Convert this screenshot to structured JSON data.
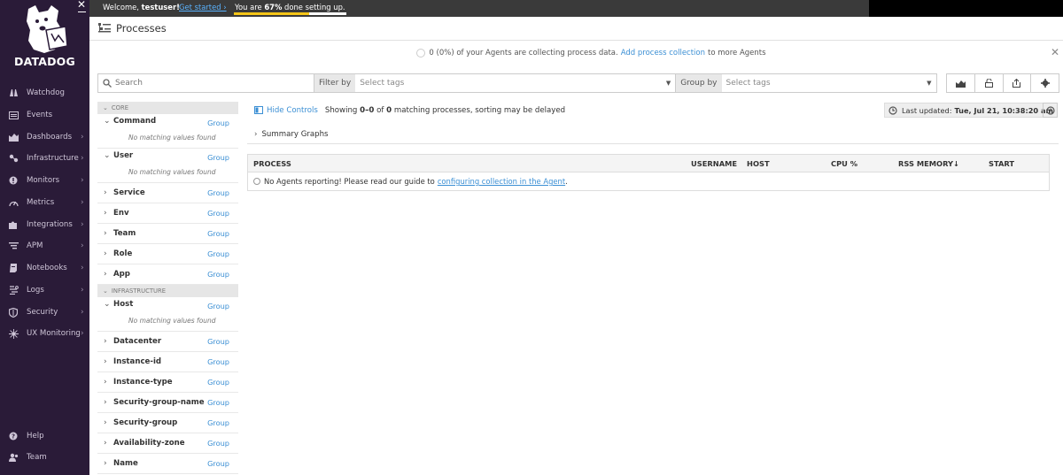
{
  "sidebar": {
    "brand": "DATADOG",
    "items": [
      {
        "label": "Watchdog",
        "icon": "binoculars-icon",
        "chevron": ""
      },
      {
        "label": "Events",
        "icon": "events-icon",
        "chevron": ""
      },
      {
        "label": "Dashboards",
        "icon": "dashboard-icon",
        "chevron": "›"
      },
      {
        "label": "Infrastructure",
        "icon": "infrastructure-icon",
        "chevron": "›"
      },
      {
        "label": "Monitors",
        "icon": "monitor-icon",
        "chevron": "›"
      },
      {
        "label": "Metrics",
        "icon": "metrics-icon",
        "chevron": "›"
      },
      {
        "label": "Integrations",
        "icon": "puzzle-icon",
        "chevron": "›"
      },
      {
        "label": "APM",
        "icon": "apm-icon",
        "chevron": "›"
      },
      {
        "label": "Notebooks",
        "icon": "notebook-icon",
        "chevron": "›"
      },
      {
        "label": "Logs",
        "icon": "logs-icon",
        "chevron": "›"
      },
      {
        "label": "Security",
        "icon": "shield-icon",
        "chevron": "›"
      },
      {
        "label": "UX Monitoring",
        "icon": "ux-icon",
        "chevron": "›"
      }
    ],
    "bottom_items": [
      {
        "label": "Help",
        "icon": "help-icon"
      },
      {
        "label": "Team",
        "icon": "team-icon"
      }
    ]
  },
  "topbar": {
    "welcome_prefix": "Welcome, ",
    "username": "testuser!",
    "get_started": "Get started ›",
    "progress_prefix": "You are ",
    "progress_percent_text": "67%",
    "progress_suffix": " done setting up.",
    "progress_value": 0.67
  },
  "header": {
    "title": "Processes"
  },
  "banner": {
    "text_before": "0 (0%) of your Agents are collecting process data.",
    "link": "Add process collection",
    "text_after": "to more Agents"
  },
  "search": {
    "placeholder": "Search",
    "filter_label": "Filter by",
    "filter_placeholder": "Select tags",
    "group_label": "Group by",
    "group_placeholder": "Select tags"
  },
  "facets": {
    "core_label": "CORE",
    "infra_label": "INFRASTRUCTURE",
    "group_label": "Group",
    "no_match": "No matching values found",
    "core": [
      {
        "name": "Command",
        "expanded": true
      },
      {
        "name": "User",
        "expanded": true
      },
      {
        "name": "Service",
        "expanded": false
      },
      {
        "name": "Env",
        "expanded": false
      },
      {
        "name": "Team",
        "expanded": false
      },
      {
        "name": "Role",
        "expanded": false
      },
      {
        "name": "App",
        "expanded": false
      }
    ],
    "infra": [
      {
        "name": "Host",
        "expanded": true
      },
      {
        "name": "Datacenter",
        "expanded": false
      },
      {
        "name": "Instance-id",
        "expanded": false
      },
      {
        "name": "Instance-type",
        "expanded": false
      },
      {
        "name": "Security-group-name",
        "expanded": false
      },
      {
        "name": "Security-group",
        "expanded": false
      },
      {
        "name": "Availability-zone",
        "expanded": false
      },
      {
        "name": "Name",
        "expanded": false
      }
    ]
  },
  "controls": {
    "hide": "Hide Controls",
    "showing_prefix": "Showing ",
    "showing_range": "0–0",
    "showing_mid": " of ",
    "showing_count": "0",
    "showing_suffix": " matching processes, sorting may be delayed",
    "updated_label": "Last updated:",
    "updated_value": "Tue, Jul 21, 10:38:20 am"
  },
  "summary": {
    "label": "Summary Graphs"
  },
  "table": {
    "columns": [
      "PROCESS",
      "USERNAME",
      "HOST",
      "CPU %",
      "RSS MEMORY↓",
      "START"
    ],
    "empty_text": "No Agents reporting! Please read our guide to",
    "empty_link": "configuring collection in the Agent",
    "empty_end": "."
  }
}
